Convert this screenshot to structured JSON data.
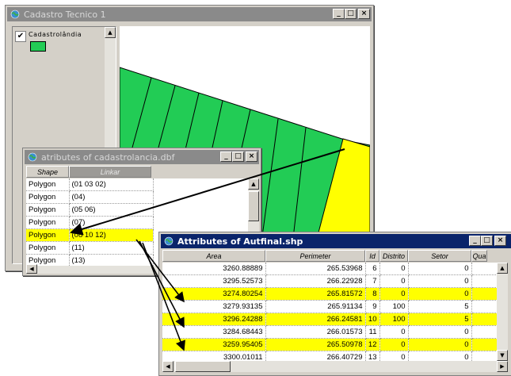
{
  "windows": {
    "map": {
      "title": "Cadastro Tecnico 1",
      "layer_name": "Cadastrolândia",
      "layer_color": "#22cc55",
      "controls": {
        "minimize": "_",
        "maximize": "□",
        "close": "×"
      }
    },
    "dbf": {
      "title": "atributes of cadastrolancia.dbf",
      "headers": [
        "Shape",
        "Linkar"
      ],
      "rows": [
        {
          "shape": "Polygon",
          "link": "(01 03 02)",
          "highlight": false
        },
        {
          "shape": "Polygon",
          "link": "(04)",
          "highlight": false
        },
        {
          "shape": "Polygon",
          "link": "(05 06)",
          "highlight": false
        },
        {
          "shape": "Polygon",
          "link": "(07)",
          "highlight": false
        },
        {
          "shape": "Polygon",
          "link": "(08 10 12)",
          "highlight": true
        },
        {
          "shape": "Polygon",
          "link": "(11)",
          "highlight": false
        },
        {
          "shape": "Polygon",
          "link": "(13)",
          "highlight": false
        }
      ]
    },
    "shp": {
      "title": "Attributes of Autfinal.shp",
      "headers": [
        "Area",
        "Perimeter",
        "Id",
        "Distrito",
        "Setor",
        "Qua"
      ],
      "rows": [
        {
          "area": "3260.88889",
          "perimeter": "265.53968",
          "id": "6",
          "distrito": "0",
          "setor": "0",
          "highlight": false
        },
        {
          "area": "3295.52573",
          "perimeter": "266.22928",
          "id": "7",
          "distrito": "0",
          "setor": "0",
          "highlight": false
        },
        {
          "area": "3274.80254",
          "perimeter": "265.81572",
          "id": "8",
          "distrito": "0",
          "setor": "0",
          "highlight": true
        },
        {
          "area": "3279.93135",
          "perimeter": "265.91134",
          "id": "9",
          "distrito": "100",
          "setor": "5",
          "highlight": false
        },
        {
          "area": "3296.24288",
          "perimeter": "266.24581",
          "id": "10",
          "distrito": "100",
          "setor": "5",
          "highlight": true
        },
        {
          "area": "3284.68443",
          "perimeter": "266.01573",
          "id": "11",
          "distrito": "0",
          "setor": "0",
          "highlight": false
        },
        {
          "area": "3259.95405",
          "perimeter": "265.50978",
          "id": "12",
          "distrito": "0",
          "setor": "0",
          "highlight": true
        },
        {
          "area": "3300.01011",
          "perimeter": "266.40729",
          "id": "13",
          "distrito": "0",
          "setor": "0",
          "highlight": false
        }
      ]
    }
  },
  "colors": {
    "parcel_fill": "#22cc55",
    "selected_fill": "#ffff00",
    "titlebar_active": "#0a246a",
    "titlebar_inactive": "#8a8a8a"
  }
}
